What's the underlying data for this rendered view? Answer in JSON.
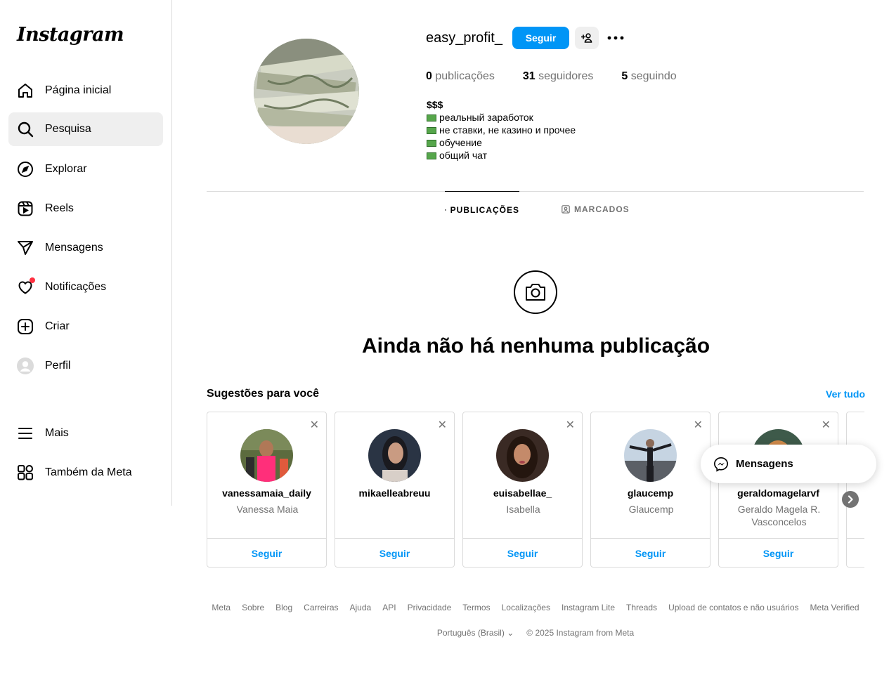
{
  "app": {
    "logo": "Instagram"
  },
  "sidebar": {
    "items": [
      {
        "label": "Página inicial",
        "icon": "home-icon"
      },
      {
        "label": "Pesquisa",
        "icon": "search-icon"
      },
      {
        "label": "Explorar",
        "icon": "compass-icon"
      },
      {
        "label": "Reels",
        "icon": "reels-icon"
      },
      {
        "label": "Mensagens",
        "icon": "send-icon"
      },
      {
        "label": "Notificações",
        "icon": "heart-icon"
      },
      {
        "label": "Criar",
        "icon": "plus-square-icon"
      },
      {
        "label": "Perfil",
        "icon": "avatar-icon"
      },
      {
        "label": "Mais",
        "icon": "menu-icon"
      },
      {
        "label": "Também da Meta",
        "icon": "apps-icon"
      }
    ],
    "active": "Pesquisa"
  },
  "profile": {
    "username": "easy_profit_",
    "follow_label": "Seguir",
    "stats": {
      "posts_count": "0",
      "posts_label": "publicações",
      "followers_count": "31",
      "followers_label": "seguidores",
      "following_count": "5",
      "following_label": "seguindo"
    },
    "bio": {
      "name": "$$$",
      "lines": [
        "реальный заработок",
        "не ставки, не казино и прочее",
        "обучение",
        "общий чат"
      ]
    }
  },
  "tabs": [
    {
      "label": "PUBLICAÇÕES",
      "icon": "grid-icon",
      "active": true
    },
    {
      "label": "MARCADOS",
      "icon": "tagged-icon",
      "active": false
    }
  ],
  "empty_state": {
    "title": "Ainda não há nenhuma publicação",
    "icon": "camera-icon"
  },
  "suggestions": {
    "title": "Sugestões para você",
    "see_all": "Ver tudo",
    "cards": [
      {
        "username": "vanessamaia_daily",
        "name": "Vanessa Maia",
        "action": "Seguir"
      },
      {
        "username": "mikaelleabreuu",
        "name": "",
        "action": "Seguir"
      },
      {
        "username": "euisabellae_",
        "name": "Isabella",
        "action": "Seguir"
      },
      {
        "username": "glaucemp",
        "name": "Glaucemp",
        "action": "Seguir"
      },
      {
        "username": "geraldomagelarvf",
        "name": "Geraldo Magela R. Vasconcelos",
        "action": "Seguir"
      }
    ]
  },
  "messages_pill": {
    "label": "Mensagens"
  },
  "footer": {
    "links": [
      "Meta",
      "Sobre",
      "Blog",
      "Carreiras",
      "Ajuda",
      "API",
      "Privacidade",
      "Termos",
      "Localizações",
      "Instagram Lite",
      "Threads",
      "Upload de contatos e não usuários",
      "Meta Verified"
    ],
    "language": "Português (Brasil)",
    "copyright": "© 2025 Instagram from Meta"
  },
  "colors": {
    "accent": "#0095f6",
    "notification": "#ff3040",
    "muted": "#737373"
  }
}
